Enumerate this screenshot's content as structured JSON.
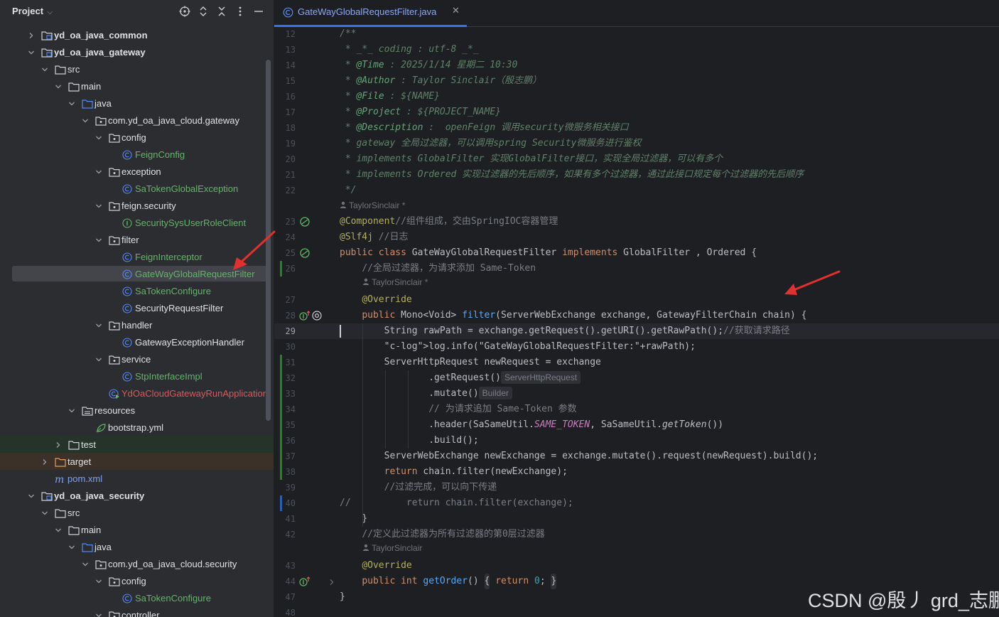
{
  "project_panel": {
    "title": "Project",
    "tree": [
      {
        "label": "yd_oa_java_common",
        "style": "bold"
      },
      {
        "label": "yd_oa_java_gateway",
        "style": "bold"
      },
      {
        "label": "src",
        "style": "normal"
      },
      {
        "label": "main",
        "style": "normal"
      },
      {
        "label": "java",
        "style": "normal"
      },
      {
        "label": "com.yd_oa_java_cloud.gateway",
        "style": "normal"
      },
      {
        "label": "config",
        "style": "normal"
      },
      {
        "label": "FeignConfig",
        "style": "green"
      },
      {
        "label": "exception",
        "style": "normal"
      },
      {
        "label": "SaTokenGlobalException",
        "style": "green"
      },
      {
        "label": "feign.security",
        "style": "normal"
      },
      {
        "label": "SecuritySysUserRoleClient",
        "style": "green"
      },
      {
        "label": "filter",
        "style": "normal"
      },
      {
        "label": "FeignInterceptor",
        "style": "green"
      },
      {
        "label": "GateWayGlobalRequestFilter",
        "style": "green"
      },
      {
        "label": "SaTokenConfigure",
        "style": "green"
      },
      {
        "label": "SecurityRequestFilter",
        "style": "normal"
      },
      {
        "label": "handler",
        "style": "normal"
      },
      {
        "label": "GatewayExceptionHandler",
        "style": "normal"
      },
      {
        "label": "service",
        "style": "normal"
      },
      {
        "label": "StpInterfaceImpl",
        "style": "green"
      },
      {
        "label": "YdOaCloudGatewayRunApplication",
        "style": "red"
      },
      {
        "label": "resources",
        "style": "normal"
      },
      {
        "label": "bootstrap.yml",
        "style": "normal"
      },
      {
        "label": "test",
        "style": "normal"
      },
      {
        "label": "target",
        "style": "normal"
      },
      {
        "label": "pom.xml",
        "style": "blue"
      },
      {
        "label": "yd_oa_java_security",
        "style": "bold"
      },
      {
        "label": "src",
        "style": "normal"
      },
      {
        "label": "main",
        "style": "normal"
      },
      {
        "label": "java",
        "style": "normal"
      },
      {
        "label": "com.yd_oa_java_cloud.security",
        "style": "normal"
      },
      {
        "label": "config",
        "style": "normal"
      },
      {
        "label": "SaTokenConfigure",
        "style": "green"
      },
      {
        "label": "controller",
        "style": "normal"
      }
    ]
  },
  "editor": {
    "tab_title": "GateWayGlobalRequestFilter.java",
    "author_hint": "TaylorSinclair *",
    "author_hint_plain": "TaylorSinclair",
    "lines": [
      {
        "n": "12",
        "text": "/**"
      },
      {
        "n": "13",
        "text": " * _*_ coding : utf-8 _*_"
      },
      {
        "n": "14",
        "text": " * @Time : 2025/1/14 星期二 10:30"
      },
      {
        "n": "15",
        "text": " * @Author : Taylor Sinclair（殷志鹏）"
      },
      {
        "n": "16",
        "text": " * @File : ${NAME}"
      },
      {
        "n": "17",
        "text": " * @Project : ${PROJECT_NAME}"
      },
      {
        "n": "18",
        "text": " * @Description :  openFeign 调用security微服务相关接口"
      },
      {
        "n": "19",
        "text": " * gateway 全局过滤器，可以调用spring Security微服务进行鉴权"
      },
      {
        "n": "20",
        "text": " * implements GlobalFilter 实现GlobalFilter接口，实现全局过滤器，可以有多个"
      },
      {
        "n": "21",
        "text": " * implements Ordered 实现过滤器的先后顺序，如果有多个过滤器，通过此接口规定每个过滤器的先后顺序"
      },
      {
        "n": "22",
        "text": " */"
      },
      {
        "n": "23",
        "text": "@Component//组件组成，交由SpringIOC容器管理"
      },
      {
        "n": "24",
        "text": "@Slf4j //日志"
      },
      {
        "n": "25",
        "text": "public class GateWayGlobalRequestFilter implements GlobalFilter , Ordered {"
      },
      {
        "n": "26",
        "text": "    //全局过滤器，为请求添加 Same-Token"
      },
      {
        "n": "27",
        "text": "    @Override"
      },
      {
        "n": "28",
        "text": "    public Mono<Void> filter(ServerWebExchange exchange, GatewayFilterChain chain) {"
      },
      {
        "n": "29",
        "text": "        String rawPath = exchange.getRequest().getURI().getRawPath();//获取请求路径"
      },
      {
        "n": "30",
        "text": "        log.info(\"GateWayGlobalRequestFilter:\"+rawPath);"
      },
      {
        "n": "31",
        "text": "        ServerHttpRequest newRequest = exchange"
      },
      {
        "n": "32",
        "text": "                .getRequest()"
      },
      {
        "n": "33",
        "text": "                .mutate()"
      },
      {
        "n": "34",
        "text": "                // 为请求追加 Same-Token 参数"
      },
      {
        "n": "35",
        "text": "                .header(SaSameUtil.SAME_TOKEN, SaSameUtil.getToken())"
      },
      {
        "n": "36",
        "text": "                .build();"
      },
      {
        "n": "37",
        "text": "        ServerWebExchange newExchange = exchange.mutate().request(newRequest).build();"
      },
      {
        "n": "38",
        "text": "        return chain.filter(newExchange);"
      },
      {
        "n": "39",
        "text": "        //过滤完成，可以向下传递"
      },
      {
        "n": "40",
        "text": "//          return chain.filter(exchange);"
      },
      {
        "n": "41",
        "text": "    }"
      },
      {
        "n": "42",
        "text": "    //定义此过滤器为所有过滤器的第0层过滤器"
      },
      {
        "n": "43",
        "text": "    @Override"
      },
      {
        "n": "44",
        "text": "    public int getOrder() { return 0; }"
      },
      {
        "n": "47",
        "text": "}"
      },
      {
        "n": "48",
        "text": ""
      }
    ],
    "inlay_request": "ServerHttpRequest",
    "inlay_builder": "Builder"
  },
  "watermark": "CSDN @殷丿 grd_志鹏",
  "colors": {
    "accent": "#3574f0",
    "green_file": "#5fb865",
    "red_file": "#e0565b",
    "annotation": "#e03030"
  }
}
